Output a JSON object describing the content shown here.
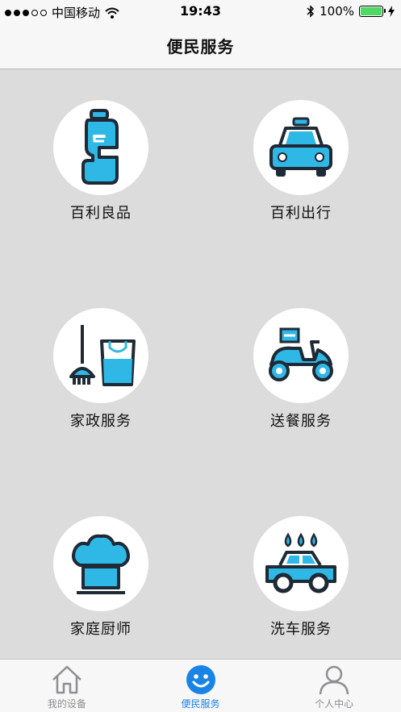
{
  "status_bar": {
    "carrier": "中国移动",
    "time": "19:43",
    "battery": "100%"
  },
  "nav": {
    "title": "便民服务"
  },
  "services": [
    {
      "label": "百利良品",
      "icon": "bottle-icon"
    },
    {
      "label": "百利出行",
      "icon": "taxi-icon"
    },
    {
      "label": "家政服务",
      "icon": "mop-bucket-icon"
    },
    {
      "label": "送餐服务",
      "icon": "delivery-scooter-icon"
    },
    {
      "label": "家庭厨师",
      "icon": "chef-hat-icon"
    },
    {
      "label": "洗车服务",
      "icon": "car-wash-icon"
    }
  ],
  "tabs": [
    {
      "label": "我的设备",
      "icon": "home-icon"
    },
    {
      "label": "便民服务",
      "icon": "smiley-icon",
      "active": true
    },
    {
      "label": "个人中心",
      "icon": "person-icon"
    }
  ],
  "colors": {
    "accent": "#1a84e6",
    "icon_fill": "#2fb7e6",
    "icon_stroke": "#1e2a35",
    "background": "#dcdcdc"
  }
}
